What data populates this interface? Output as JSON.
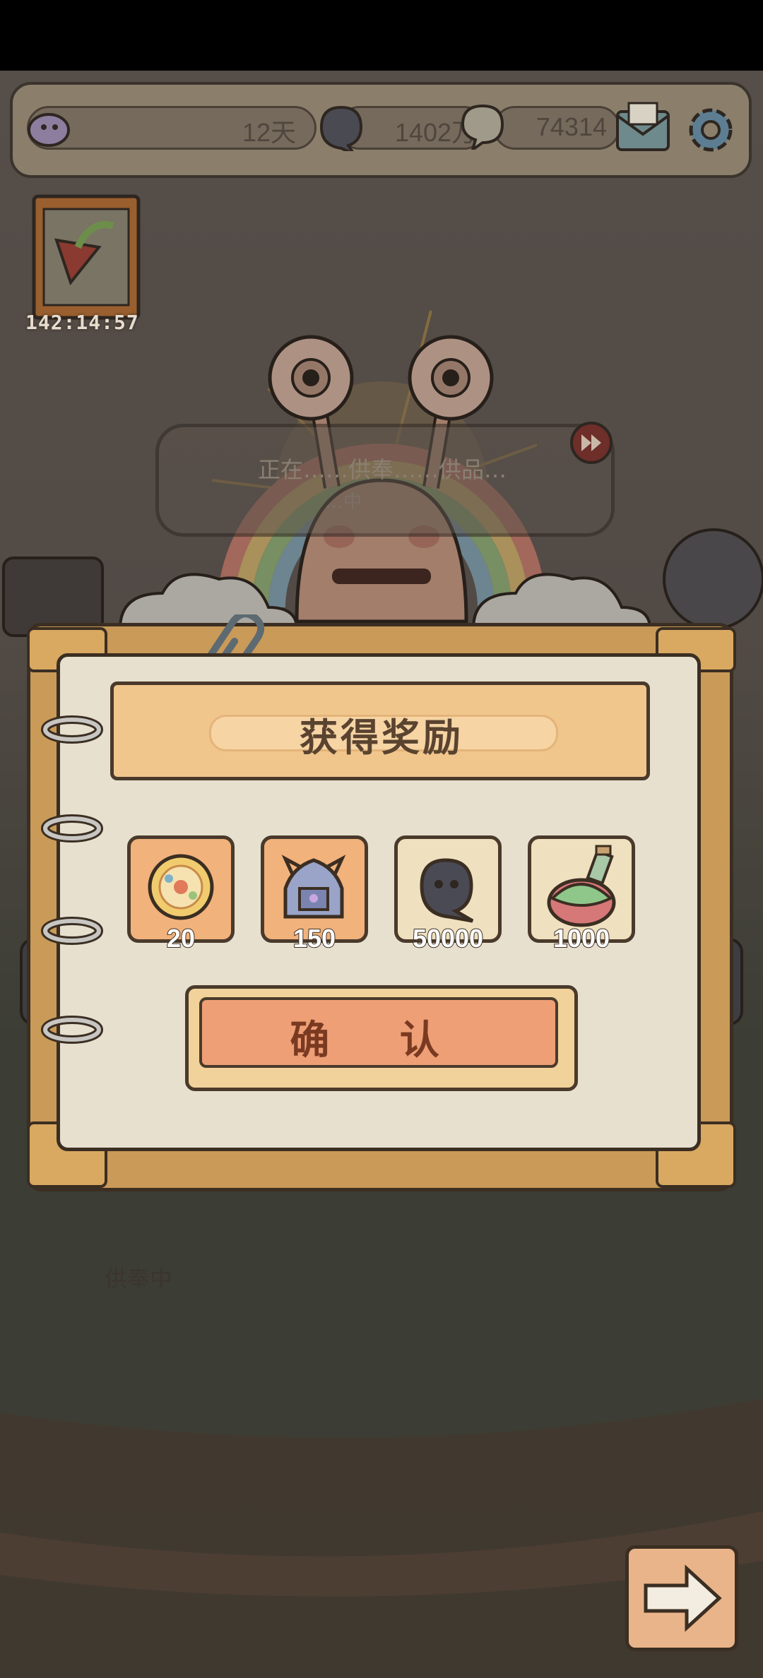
{
  "topbar": {
    "days": "12天",
    "ghost_currency": "1402万",
    "soul_currency": "74314"
  },
  "event_card": {
    "timer": "142:14:57"
  },
  "bubble": {
    "text": "正在……供奉……供品…",
    "sub": "…中"
  },
  "offering_label": "供奉中",
  "dialog": {
    "title": "获得奖励",
    "rewards": [
      {
        "name": "orb-coin-icon",
        "count": "20"
      },
      {
        "name": "armor-chest-icon",
        "count": "150"
      },
      {
        "name": "dark-ghost-icon",
        "count": "50000"
      },
      {
        "name": "potion-bottle-icon",
        "count": "1000"
      }
    ],
    "confirm_label": "确 认"
  },
  "colors": {
    "dialog_frame": "#c99a58",
    "dialog_inner": "#e7e0cf",
    "title_banner": "#f0c68c",
    "confirm_button": "#ee9f76",
    "reward_highlight": "#f2b27c",
    "reward_normal": "#efe0bf"
  }
}
